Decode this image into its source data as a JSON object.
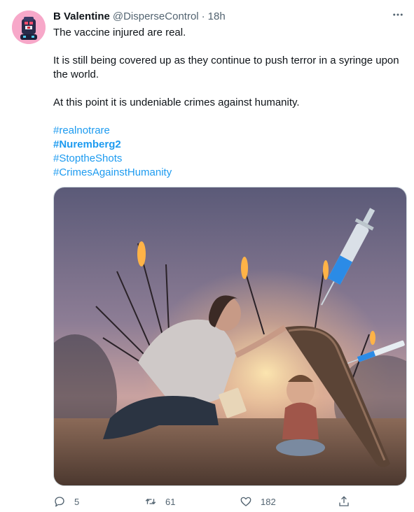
{
  "tweet": {
    "author_name": "B Valentine",
    "handle": "@DisperseControl",
    "separator": "·",
    "time": "18h",
    "paragraphs": [
      "The vaccine injured are real.",
      "It is still being covered up as they continue to push terror in a syringe upon the world.",
      "At this point it is undeniable crimes against humanity."
    ],
    "hashtags": [
      "#realnotrare",
      "#Nuremberg2",
      "#StoptheShots",
      "#CrimesAgainstHumanity"
    ],
    "media_icon": "illustration-mother-shielding-child-from-flaming-arrows-and-syringes"
  },
  "actions": {
    "reply_count": "5",
    "retweet_count": "61",
    "like_count": "182"
  },
  "icons": {
    "more": "more-icon",
    "reply": "reply-icon",
    "retweet": "retweet-icon",
    "like": "like-icon",
    "share": "share-icon"
  },
  "colors": {
    "accent": "#1d9bf0",
    "secondary_text": "#536471",
    "avatar_bg": "#f7a8c9"
  }
}
